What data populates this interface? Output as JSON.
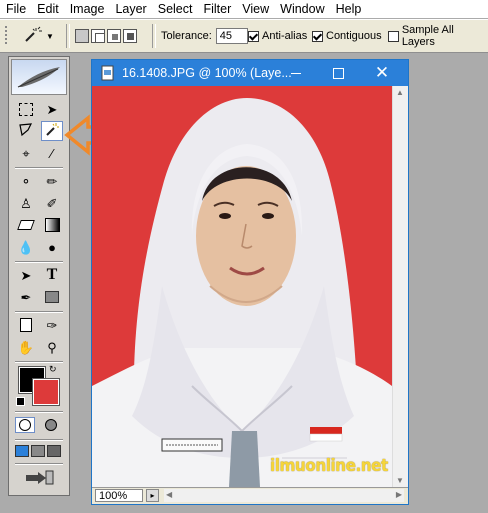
{
  "menubar": {
    "items": [
      "File",
      "Edit",
      "Image",
      "Layer",
      "Select",
      "Filter",
      "View",
      "Window",
      "Help"
    ]
  },
  "options_bar": {
    "tool_icon": "magic-wand-icon",
    "tolerance_label": "Tolerance:",
    "tolerance_value": "45",
    "antialias": {
      "label": "Anti-alias",
      "checked": true
    },
    "contiguous": {
      "label": "Contiguous",
      "checked": true
    },
    "sample_all_layers": {
      "label": "Sample All Layers",
      "checked": false
    }
  },
  "toolbox": {
    "active_tool": "magic-wand-tool",
    "foreground_color": "#000000",
    "background_color": "#dd3a3a"
  },
  "document": {
    "title": "16.1408.JPG @ 100% (Laye...",
    "zoom": "100%",
    "window_buttons": [
      "minimize",
      "maximize",
      "close"
    ],
    "photo_background_color": "#dd3a3a"
  },
  "watermark": "ilmuonline.net",
  "annotation": {
    "type": "arrow",
    "color": "#f0892a",
    "points_to": "magic-wand-tool"
  }
}
